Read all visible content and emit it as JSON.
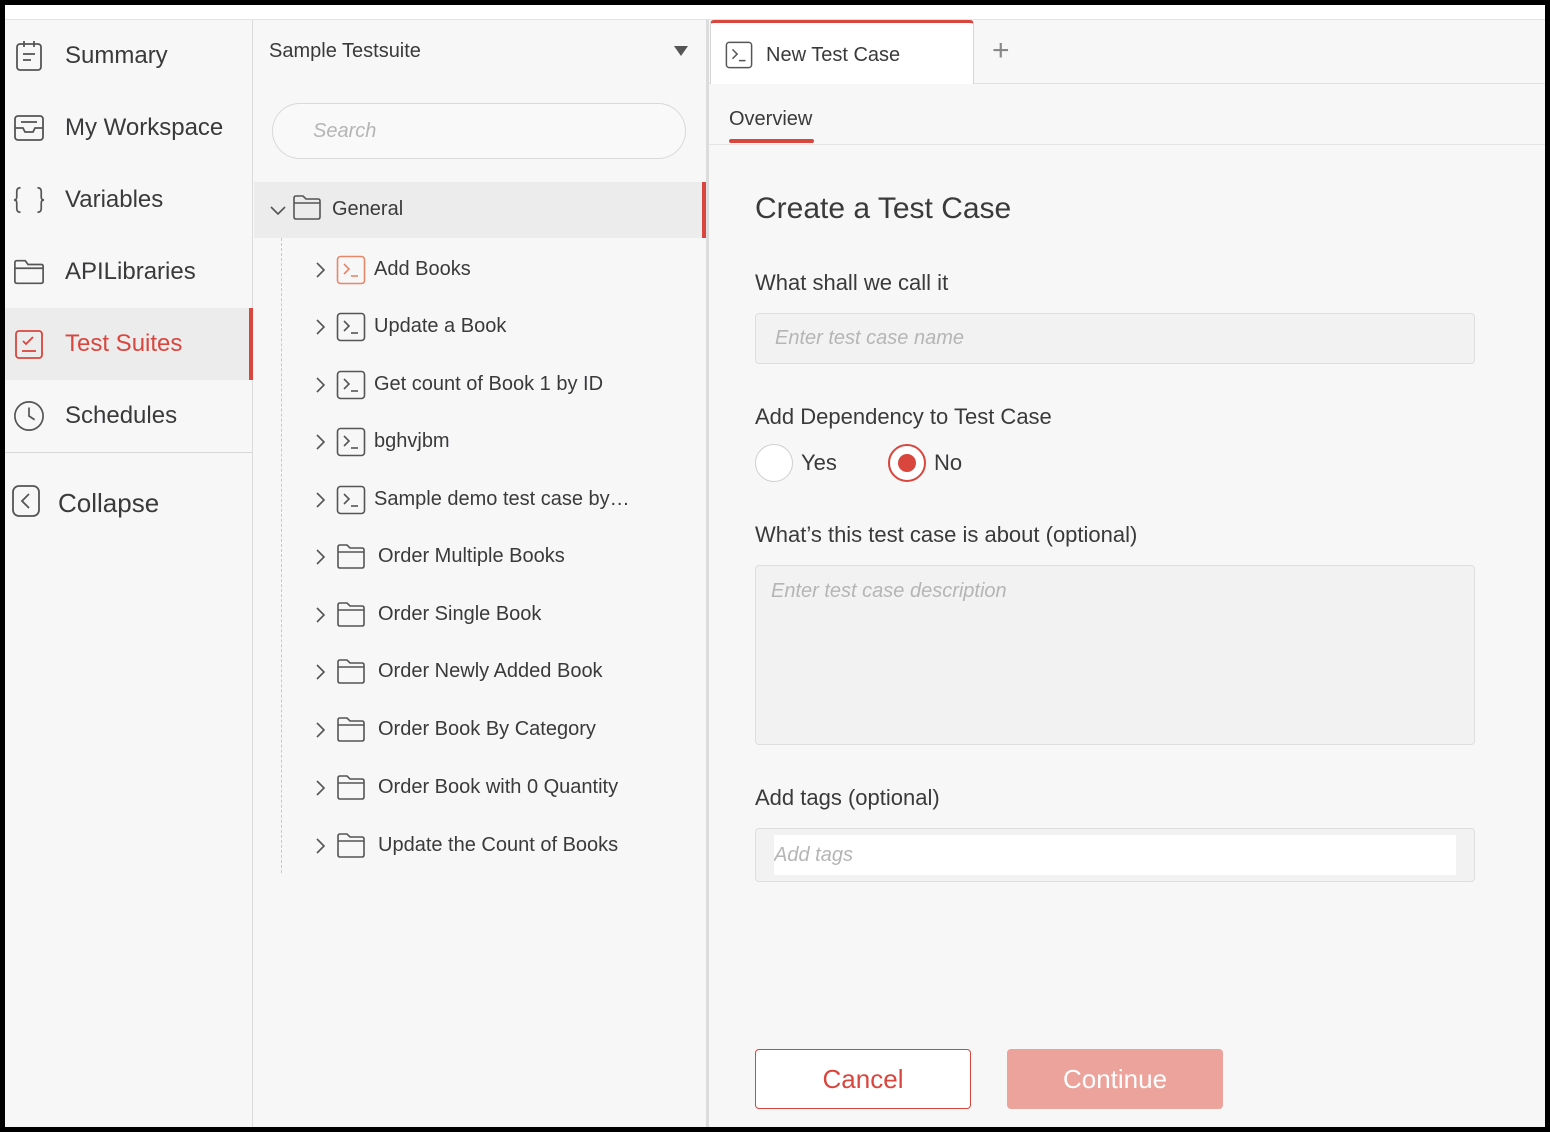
{
  "nav": {
    "items": [
      {
        "label": "Summary",
        "icon": "clipboard-icon"
      },
      {
        "label": "My Workspace",
        "icon": "inbox-tray-icon"
      },
      {
        "label": "Variables",
        "icon": "curly-braces-icon"
      },
      {
        "label": "APILibraries",
        "icon": "folder-icon"
      },
      {
        "label": "Test Suites",
        "icon": "checklist-icon",
        "active": true
      },
      {
        "label": "Schedules",
        "icon": "clock-icon"
      }
    ],
    "collapse_label": "Collapse"
  },
  "tree": {
    "suite_name": "Sample Testsuite",
    "search_placeholder": "Search",
    "root_label": "General",
    "items": [
      {
        "label": "Add Books",
        "type": "testcase",
        "highlight": true
      },
      {
        "label": "Update a Book",
        "type": "testcase"
      },
      {
        "label": "Get count of Book 1 by ID",
        "type": "testcase"
      },
      {
        "label": "bghvjbm",
        "type": "testcase"
      },
      {
        "label": "Sample demo test case by…",
        "type": "testcase"
      },
      {
        "label": "Order Multiple Books",
        "type": "folder"
      },
      {
        "label": "Order Single Book",
        "type": "folder"
      },
      {
        "label": "Order Newly Added Book",
        "type": "folder"
      },
      {
        "label": "Order Book By Category",
        "type": "folder"
      },
      {
        "label": "Order Book with 0 Quantity",
        "type": "folder"
      },
      {
        "label": "Update the Count of Books",
        "type": "folder"
      }
    ]
  },
  "tabs": {
    "active_label": "New Test Case",
    "add_label": "+"
  },
  "subnav": {
    "overview_label": "Overview"
  },
  "form": {
    "title": "Create a Test Case",
    "name_label": "What shall we call it",
    "name_placeholder": "Enter test case name",
    "dependency_label": "Add Dependency to Test Case",
    "yes_label": "Yes",
    "no_label": "No",
    "dependency_selected": "No",
    "description_label": "What’s this test case is about (optional)",
    "description_placeholder": "Enter test case description",
    "tags_label": "Add tags (optional)",
    "tags_placeholder": "Add tags",
    "cancel_label": "Cancel",
    "continue_label": "Continue"
  },
  "colors": {
    "accent": "#d9463e",
    "continue_disabled": "#eba39c"
  }
}
